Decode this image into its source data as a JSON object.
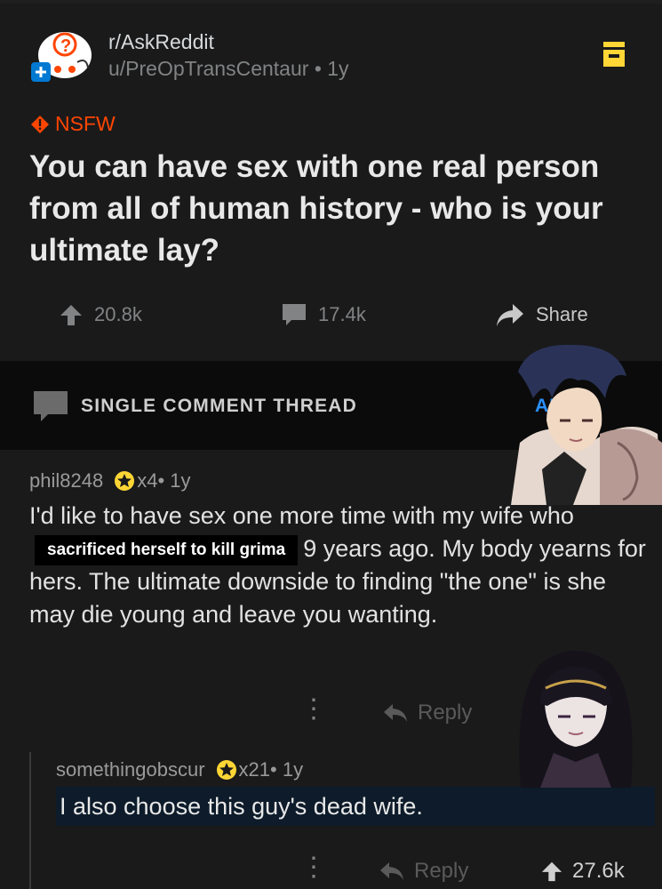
{
  "post": {
    "subreddit": "r/AskReddit",
    "author": "u/PreOpTransCentaur",
    "age": "1y",
    "flair": "NSFW",
    "title": "You can have sex with one real person from all of human history - who is your ultimate lay?",
    "upvotes": "20.8k",
    "comments": "17.4k",
    "share_label": "Share"
  },
  "thread_band": {
    "label": "SINGLE COMMENT THREAD",
    "view_all_visible": "ALL"
  },
  "comment1": {
    "author": "phil8248",
    "award_count": "x4",
    "age": "1y",
    "text_before": "I'd like to have sex one more time with my wife who",
    "redaction": "sacrificed herself to kill grima",
    "text_after": "9 years ago. My body yearns for hers. The ultimate downside to finding \"the one\" is she may die young and leave you wanting.",
    "reply_label": "Reply"
  },
  "comment2": {
    "author": "somethingobscur",
    "award_count": "x21",
    "age": "1y",
    "text": "I also choose this guy's dead wife.",
    "reply_label": "Reply",
    "score": "27.6k"
  },
  "colors": {
    "nsfw": "#ff4500",
    "award": "#ffd635",
    "save": "#ffd635",
    "link": "#2b91ff"
  }
}
